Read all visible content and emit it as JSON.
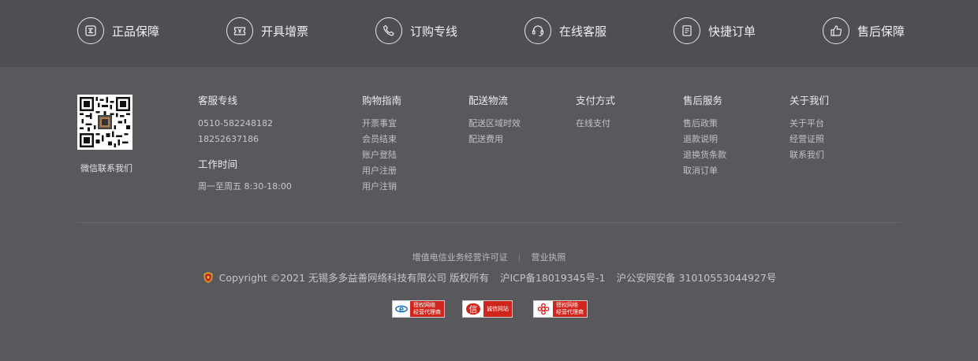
{
  "features": [
    {
      "label": "正品保障",
      "icon": "genuine-icon"
    },
    {
      "label": "开具增票",
      "icon": "invoice-icon"
    },
    {
      "label": "订购专线",
      "icon": "phone-icon"
    },
    {
      "label": "在线客服",
      "icon": "headset-icon"
    },
    {
      "label": "快捷订单",
      "icon": "document-icon"
    },
    {
      "label": "售后保障",
      "icon": "thumbs-up-icon"
    }
  ],
  "qr": {
    "caption": "微信联系我们",
    "icon": "qr-code-icon"
  },
  "service": {
    "title": "客服专线",
    "phones": [
      "0510-582248182",
      "18252637186"
    ],
    "hours_title": "工作时间",
    "hours": "周一至周五 8:30-18:00"
  },
  "columns": [
    {
      "title": "购物指南",
      "links": [
        "开票事宜",
        "会员结束",
        "账户登陆",
        "用户注册",
        "用户注销"
      ]
    },
    {
      "title": "配送物流",
      "links": [
        "配送区域时效",
        "配送费用"
      ]
    },
    {
      "title": "支付方式",
      "links": [
        "在线支付"
      ]
    },
    {
      "title": "售后服务",
      "links": [
        "售后政策",
        "退款说明",
        "退换货条款",
        "取消订单"
      ]
    },
    {
      "title": "关于我们",
      "links": [
        "关于平台",
        "经营证照",
        "联系我们"
      ]
    }
  ],
  "license_links": [
    "增值电信业务经营许可证",
    "营业执照"
  ],
  "license_separator": "|",
  "copyright": {
    "text": "Copyright ©2021 无锡多多益善网络科技有限公司 版权所有",
    "icp": "沪ICP备18019345号-1",
    "police": "沪公安网安备 31010553044927号"
  },
  "badges": [
    {
      "name": "telecom-badge",
      "line1": "授权网络",
      "line2": "经营代理商",
      "logo_char": "e",
      "logo_color": "#1e6fc0"
    },
    {
      "name": "trust-badge",
      "line1": "诚信网站",
      "line2": "",
      "logo_char": "信",
      "logo_color": "#d0251c"
    },
    {
      "name": "unicom-badge",
      "line1": "授权网络",
      "line2": "经营代理商",
      "logo_char": "",
      "logo_color": "#d0251c"
    }
  ],
  "colors": {
    "top_bar": "#4e4e53",
    "footer_bg": "#58585d",
    "badge_red": "#d0251c"
  }
}
